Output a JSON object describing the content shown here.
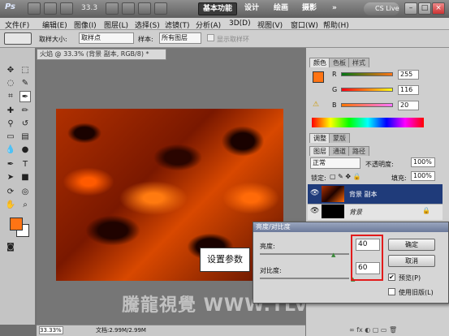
{
  "titlebar": {
    "logo": "Ps",
    "zoom": "33.3",
    "workspaces": [
      "基本功能",
      "设计",
      "绘画",
      "摄影"
    ],
    "more": "»",
    "cslive": "CS Live",
    "min": "–",
    "max": "□",
    "close": "×"
  },
  "menu": [
    "文件(F)",
    "编辑(E)",
    "图像(I)",
    "图层(L)",
    "选择(S)",
    "滤镜(T)",
    "分析(A)",
    "3D(D)",
    "视图(V)",
    "窗口(W)",
    "帮助(H)"
  ],
  "options": {
    "sample_size_label": "取样大小:",
    "sample_size_value": "取样点",
    "sample_label": "样本:",
    "sample_value": "所有图层",
    "show_ring": "显示取样环"
  },
  "document": {
    "tab_title": "火焰 @ 33.3% (背景 副本, RGB/8) *",
    "zoom_status": "33.33%",
    "doc_status": "文档:2.99M/2.99M"
  },
  "color_panel": {
    "tabs": [
      "颜色",
      "色板",
      "样式"
    ],
    "r_label": "R",
    "r_value": "255",
    "g_label": "G",
    "g_value": "116",
    "b_label": "B",
    "b_value": "20",
    "foreground_color": "#ff7414"
  },
  "adjust_panel": {
    "tabs": [
      "调整",
      "蒙版"
    ]
  },
  "layers_panel": {
    "tabs": [
      "图层",
      "通道",
      "路径"
    ],
    "blend_mode": "正常",
    "opacity_label": "不透明度:",
    "opacity_value": "100%",
    "lock_label": "锁定:",
    "fill_label": "填充:",
    "fill_value": "100%",
    "layers": [
      {
        "name": "背景 副本",
        "selected": true
      },
      {
        "name": "背景",
        "selected": false
      }
    ]
  },
  "dialog": {
    "title": "亮度/对比度",
    "brightness_label": "亮度:",
    "brightness_value": "40",
    "contrast_label": "对比度:",
    "contrast_value": "60",
    "ok": "确定",
    "cancel": "取消",
    "preview_label": "预览(P)",
    "preview_checked": true,
    "legacy_label": "使用旧版(L)",
    "legacy_checked": false
  },
  "callout": "设置参数",
  "watermark": "騰龍視覺 WWW.TLVI.NET"
}
